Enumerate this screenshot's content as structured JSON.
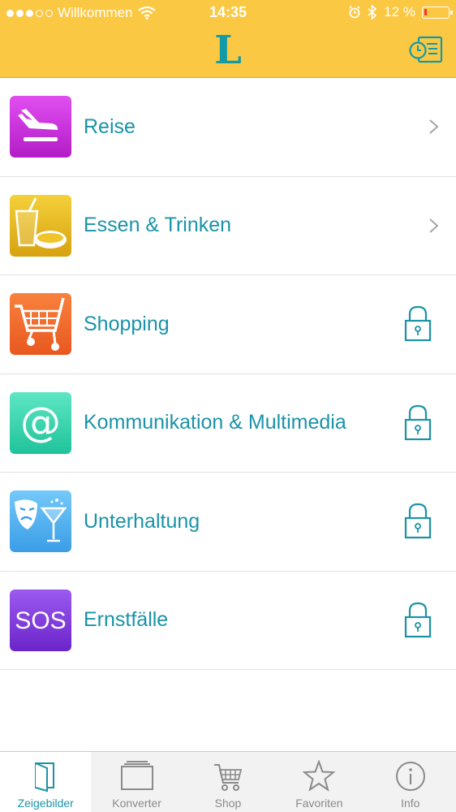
{
  "status_bar": {
    "carrier": "Willkommen",
    "time": "14:35",
    "battery": "12 %",
    "battery_level": 0.12,
    "signal_bars": 3,
    "icons": [
      "wifi-icon",
      "alarm-icon",
      "bluetooth-icon"
    ]
  },
  "header": {
    "logo": "L",
    "history_icon": "history-icon"
  },
  "categories": [
    {
      "label": "Reise",
      "icon": "airplane-landing-icon",
      "locked": false
    },
    {
      "label": "Essen & Trinken",
      "icon": "food-drink-icon",
      "locked": false
    },
    {
      "label": "Shopping",
      "icon": "shopping-cart-icon",
      "locked": true
    },
    {
      "label": "Kommunikation & Multimedia",
      "icon": "at-sign-icon",
      "locked": true
    },
    {
      "label": "Unterhaltung",
      "icon": "theater-masks-icon",
      "locked": true
    },
    {
      "label": "Ernstfälle",
      "icon": "sos-icon",
      "locked": true
    }
  ],
  "tabs": [
    {
      "label": "Zeigebilder",
      "icon": "book-icon",
      "active": true
    },
    {
      "label": "Konverter",
      "icon": "converter-icon",
      "active": false
    },
    {
      "label": "Shop",
      "icon": "cart-icon",
      "active": false
    },
    {
      "label": "Favoriten",
      "icon": "star-icon",
      "active": false
    },
    {
      "label": "Info",
      "icon": "info-icon",
      "active": false
    }
  ],
  "colors": {
    "header": "#fbc843",
    "accent": "#1a93a8",
    "tab_inactive": "#8a8a8a"
  }
}
